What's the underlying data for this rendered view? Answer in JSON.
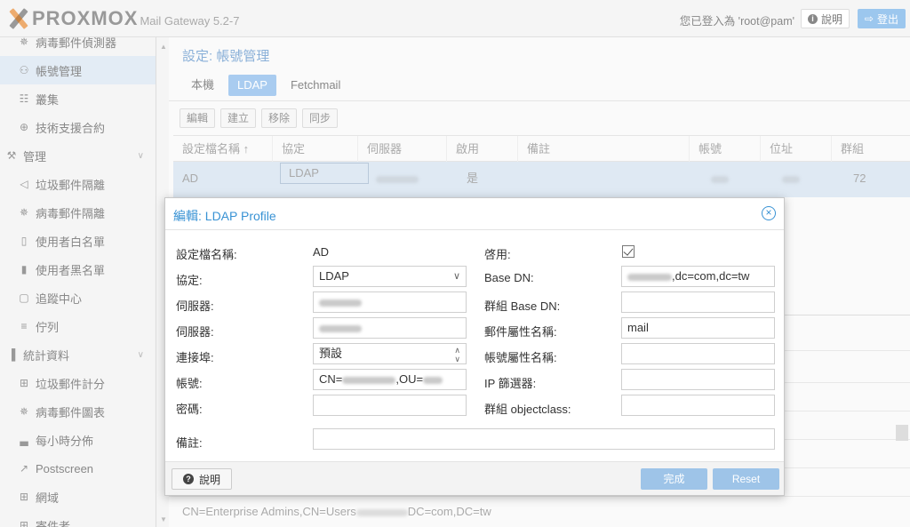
{
  "header": {
    "logo_text": "PROXMOX",
    "app_name": "Mail Gateway 5.2-7",
    "user_text": "您已登入為 'root@pam'",
    "help_label": "說明",
    "logout_label": "登出"
  },
  "sidebar": {
    "items": [
      {
        "label": "病毒郵件偵測器",
        "icon": "bug-icon"
      },
      {
        "label": "帳號管理",
        "icon": "users-icon"
      },
      {
        "label": "叢集",
        "icon": "server-icon"
      },
      {
        "label": "技術支援合約",
        "icon": "life-ring-icon"
      },
      {
        "label": "管理",
        "icon": "wrench-icon"
      },
      {
        "label": "垃圾郵件隔離",
        "icon": "bullhorn-icon"
      },
      {
        "label": "病毒郵件隔離",
        "icon": "bug-icon"
      },
      {
        "label": "使用者白名單",
        "icon": "file-icon"
      },
      {
        "label": "使用者黑名單",
        "icon": "file-solid-icon"
      },
      {
        "label": "追蹤中心",
        "icon": "map-icon"
      },
      {
        "label": "佇列",
        "icon": "list-icon"
      },
      {
        "label": "統計資料",
        "icon": "bar-chart-icon"
      },
      {
        "label": "垃圾郵件計分",
        "icon": "table-icon"
      },
      {
        "label": "病毒郵件圖表",
        "icon": "bug-icon"
      },
      {
        "label": "每小時分佈",
        "icon": "area-chart-icon"
      },
      {
        "label": "Postscreen",
        "icon": "line-chart-icon"
      },
      {
        "label": "網域",
        "icon": "table-icon"
      },
      {
        "label": "寄件者",
        "icon": "table-icon"
      }
    ]
  },
  "main": {
    "title": "設定: 帳號管理",
    "tabs": [
      "本機",
      "LDAP",
      "Fetchmail"
    ],
    "toolbar": [
      "編輯",
      "建立",
      "移除",
      "同步"
    ],
    "columns": [
      "設定檔名稱 ↑",
      "協定",
      "伺服器",
      "啟用",
      "備註",
      "帳號",
      "位址",
      "群組"
    ],
    "row": {
      "profile": "AD",
      "protocol": "LDAP",
      "enabled": "是",
      "groups": "72"
    },
    "bottom_text_a": "CN=Enterprise Admins,CN=Users",
    "bottom_text_b": "DC=com,DC=tw"
  },
  "modal": {
    "title": "編輯: LDAP Profile",
    "fields": {
      "profile_name_label": "設定檔名稱:",
      "profile_name_value": "AD",
      "protocol_label": "協定:",
      "protocol_value": "LDAP",
      "server1_label": "伺服器:",
      "server2_label": "伺服器:",
      "port_label": "連接埠:",
      "port_value": "預設",
      "account_label": "帳號:",
      "account_value_a": "CN=",
      "account_value_b": ",OU=",
      "password_label": "密碼:",
      "comment_label": "備註:",
      "enabled_label": "啓用:",
      "basedn_label": "Base DN:",
      "basedn_value": ",dc=com,dc=tw",
      "group_basedn_label": "群組 Base DN:",
      "mail_attr_label": "郵件屬性名稱:",
      "mail_attr_value": "mail",
      "account_attr_label": "帳號屬性名稱:",
      "ip_filter_label": "IP 篩選器:",
      "group_objectclass_label": "群組 objectclass:"
    },
    "footer": {
      "help_label": "說明",
      "ok_label": "完成",
      "reset_label": "Reset"
    }
  },
  "colors": {
    "accent": "#3892d4",
    "tab_active": "#a9ccf0",
    "selected_row": "#dfe9f3"
  }
}
